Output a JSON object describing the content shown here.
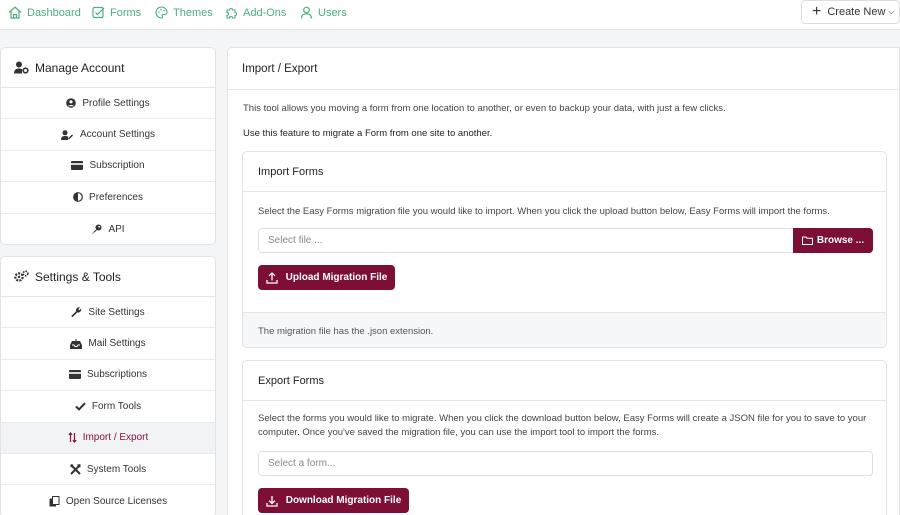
{
  "topnav": {
    "items": [
      {
        "label": "Dashboard",
        "icon": "home-icon"
      },
      {
        "label": "Forms",
        "icon": "forms-icon"
      },
      {
        "label": "Themes",
        "icon": "palette-icon"
      },
      {
        "label": "Add-Ons",
        "icon": "puzzle-icon"
      },
      {
        "label": "Users",
        "icon": "users-icon"
      }
    ],
    "create_label": "Create New",
    "accent": "#4caf7d"
  },
  "account_panel": {
    "title": "Manage Account",
    "items": [
      {
        "label": "Profile Settings",
        "icon": "user-circle-icon"
      },
      {
        "label": "Account Settings",
        "icon": "user-edit-icon"
      },
      {
        "label": "Subscription",
        "icon": "credit-card-icon"
      },
      {
        "label": "Preferences",
        "icon": "contrast-icon"
      },
      {
        "label": "API",
        "icon": "key-icon"
      }
    ]
  },
  "tools_panel": {
    "title": "Settings & Tools",
    "items": [
      {
        "label": "Site Settings",
        "icon": "wrench-icon"
      },
      {
        "label": "Mail Settings",
        "icon": "inbox-icon"
      },
      {
        "label": "Subscriptions",
        "icon": "credit-card-icon"
      },
      {
        "label": "Form Tools",
        "icon": "check-icon"
      },
      {
        "label": "Import / Export",
        "icon": "sort-arrows-icon",
        "active": true
      },
      {
        "label": "System Tools",
        "icon": "tools-icon"
      },
      {
        "label": "Open Source Licenses",
        "icon": "copy-icon"
      }
    ]
  },
  "main": {
    "title": "Import / Export",
    "intro": "This tool allows you moving a form from one location to another, or even to backup your data, with just a few clicks.",
    "intro_bold": "Use this feature to migrate a Form from one site to another.",
    "import": {
      "title": "Import Forms",
      "text": "Select the Easy Forms migration file you would like to import. When you click the upload button below, Easy Forms will import the forms.",
      "file_placeholder": "Select file ...",
      "browse_label": "Browse ...",
      "upload_label": "Upload Migration File",
      "footer": "The migration file has the .json extension."
    },
    "export": {
      "title": "Export Forms",
      "text": "Select the forms you would like to migrate. When you click the download button below, Easy Forms will create a JSON file for you to save to your computer. Once you've saved the migration file, you can use the import tool to import the forms.",
      "select_placeholder": "Select a form...",
      "download_label": "Download Migration File"
    }
  },
  "colors": {
    "primary": "#7d0e36",
    "nav_green": "#4caf7d"
  }
}
